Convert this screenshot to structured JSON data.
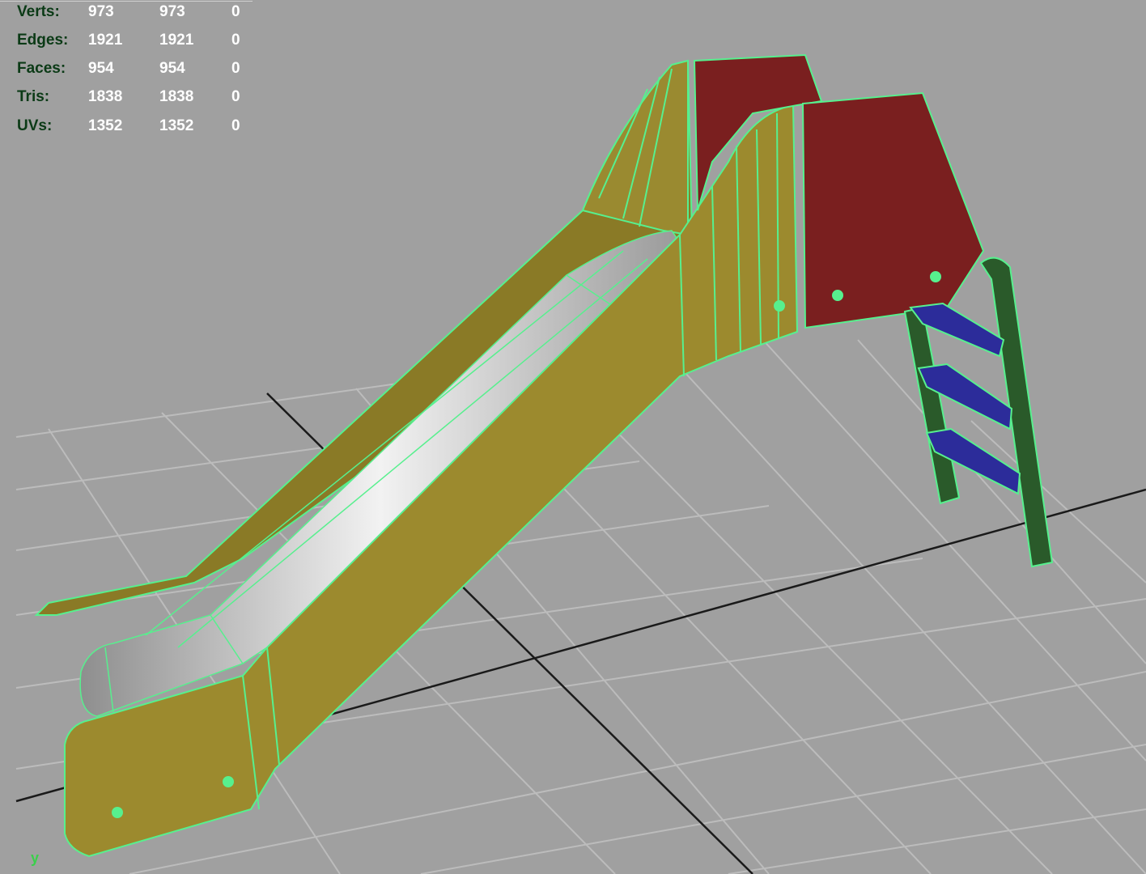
{
  "hud": {
    "rows": [
      {
        "label": "Verts:",
        "v1": "973",
        "v2": "973",
        "v3": "0"
      },
      {
        "label": "Edges:",
        "v1": "1921",
        "v2": "1921",
        "v3": "0"
      },
      {
        "label": "Faces:",
        "v1": "954",
        "v2": "954",
        "v3": "0"
      },
      {
        "label": "Tris:",
        "v1": "1838",
        "v2": "1838",
        "v3": "0"
      },
      {
        "label": "UVs:",
        "v1": "1352",
        "v2": "1352",
        "v3": "0"
      }
    ]
  },
  "axis": {
    "y_label": "y"
  },
  "colors": {
    "viewport_bg": "#a0a0a0",
    "grid": "#bcbcbc",
    "grid_axis": "#1a1a1a",
    "wireframe": "#57f08e",
    "wood": "#9c8a2e",
    "panel": "#7a1f1f",
    "rung": "#2c2c9a",
    "ladder_rail": "#2a5a2a",
    "chute": "#e6e6e6"
  }
}
